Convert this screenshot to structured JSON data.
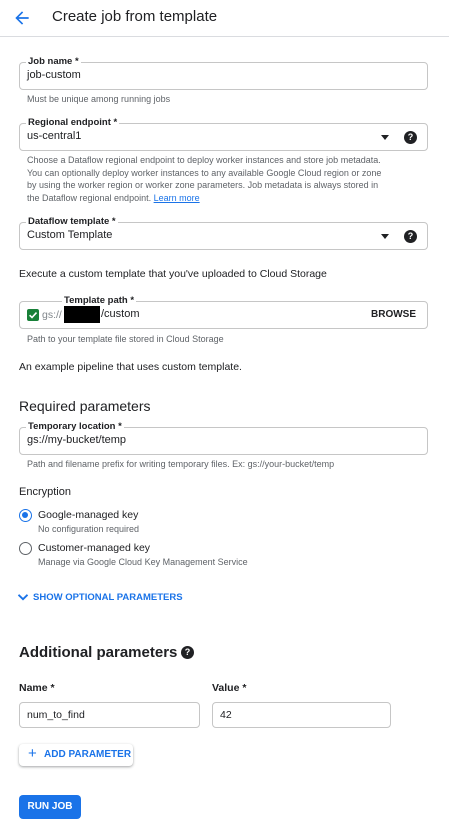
{
  "header": {
    "title": "Create job from template"
  },
  "job_name": {
    "label": "Job name *",
    "value": "job-custom",
    "hint": "Must be unique among running jobs"
  },
  "regional_endpoint": {
    "label": "Regional endpoint *",
    "value": "us-central1",
    "hint_lines": [
      "Choose a Dataflow regional endpoint to deploy worker instances and store job metadata.",
      "You can optionally deploy worker instances to any available Google Cloud region or zone",
      "by using the worker region or worker zone parameters. Job metadata is always stored in",
      "the Dataflow regional endpoint."
    ],
    "learn_more": "Learn more"
  },
  "dataflow_template": {
    "label": "Dataflow template *",
    "value": "Custom Template",
    "description": "Execute a custom template that you've uploaded to Cloud Storage"
  },
  "template_path": {
    "label": "Template path *",
    "prefix": "gs://",
    "suffix": "/custom",
    "browse": "BROWSE",
    "hint": "Path to your template file stored in Cloud Storage"
  },
  "example_text": "An example pipeline that uses custom template.",
  "required": {
    "title": "Required parameters",
    "temp_location": {
      "label": "Temporary location *",
      "value": "gs://my-bucket/temp",
      "hint": "Path and filename prefix for writing temporary files. Ex: gs://your-bucket/temp"
    }
  },
  "encryption": {
    "title": "Encryption",
    "options": [
      {
        "label": "Google-managed key",
        "hint": "No configuration required",
        "selected": true
      },
      {
        "label": "Customer-managed key",
        "hint": "Manage via Google Cloud Key Management Service",
        "selected": false
      }
    ]
  },
  "optional_toggle": "SHOW OPTIONAL PARAMETERS",
  "additional": {
    "title": "Additional parameters",
    "name_header": "Name *",
    "value_header": "Value *",
    "name_value": "num_to_find",
    "value_value": "42",
    "add_button": "ADD PARAMETER"
  },
  "run_button": "RUN JOB",
  "colors": {
    "accent": "#1a73e8",
    "valid_check": "#188038",
    "border": "#c6c6c6"
  },
  "icons": [
    "back-arrow-icon",
    "dropdown-caret-icon",
    "help-icon",
    "check-icon",
    "chevron-down-icon",
    "plus-icon"
  ]
}
